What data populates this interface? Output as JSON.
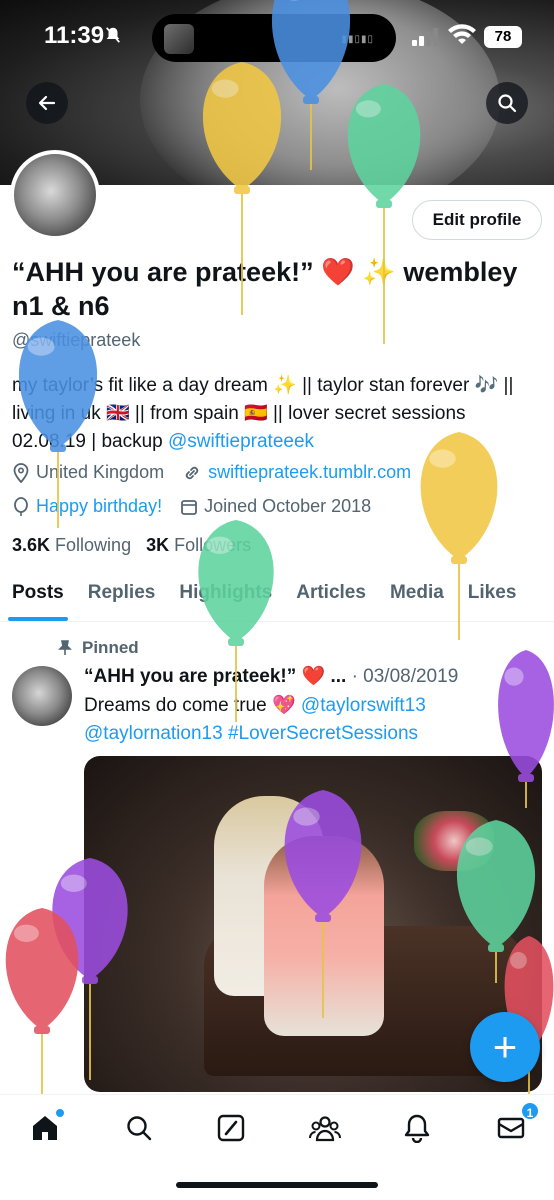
{
  "status_bar": {
    "time": "11:39",
    "battery": "78"
  },
  "profile": {
    "display_name": "“AHH you are prateek!” ❤️ ✨ wembley n1 & n6",
    "handle": "@swiftieprateek",
    "edit_button": "Edit profile",
    "bio_main": "my taylor’s fit like a day dream ✨ || taylor stan forever 🎶 || living in uk 🇬🇧 || from spain 🇪🇸 || lover secret sessions 02.08.19 | backup ",
    "bio_mention": "@swiftieprateeek",
    "location": "United Kingdom",
    "website": "swiftieprateek.tumblr.com",
    "birthday": "Happy birthday!",
    "joined": "Joined October 2018",
    "following_count": "3.6K",
    "following_label": "Following",
    "followers_count": "3K",
    "followers_label": "Followers"
  },
  "tabs": [
    "Posts",
    "Replies",
    "Highlights",
    "Articles",
    "Media",
    "Likes"
  ],
  "post": {
    "pinned_label": "Pinned",
    "author": "“AHH you are prateek!” ❤️ ...",
    "date": "· 03/08/2019",
    "text": "Dreams do come true 💖 ",
    "mention1": "@taylorswift13",
    "mention2": "@taylornation13",
    "hashtag": "#LoverSecretSessions"
  },
  "bottom_nav": {
    "messages_badge": "1"
  },
  "colors": {
    "accent": "#1d9bf0",
    "text": "#0f1419",
    "secondary": "#536471"
  }
}
